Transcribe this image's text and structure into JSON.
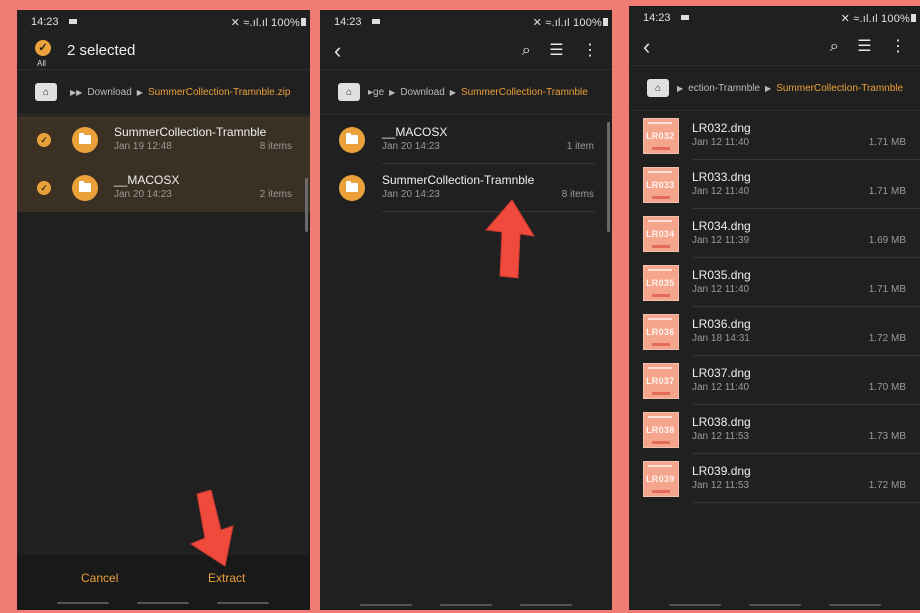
{
  "status": {
    "time": "14:23",
    "right": "✕ ≈.ıl.ıl 100%"
  },
  "panel1": {
    "selected_title": "2 selected",
    "all_label": "All",
    "breadcrumb": {
      "parent": "Download",
      "current": "SummerCollection-Tramnble.zip"
    },
    "items": [
      {
        "name": "SummerCollection-Tramnble",
        "date": "Jan 19 12:48",
        "meta": "8 items"
      },
      {
        "name": "__MACOSX",
        "date": "Jan 20 14:23",
        "meta": "2 items"
      }
    ],
    "cancel_label": "Cancel",
    "extract_label": "Extract"
  },
  "panel2": {
    "breadcrumb": {
      "prefix": "▸ge",
      "parent": "Download",
      "current": "SummerCollection-Tramnble"
    },
    "items": [
      {
        "name": "__MACOSX",
        "date": "Jan 20 14:23",
        "meta": "1 item"
      },
      {
        "name": "SummerCollection-Tramnble",
        "date": "Jan 20 14:23",
        "meta": "8 items"
      }
    ]
  },
  "panel3": {
    "breadcrumb": {
      "parent": "ection-Tramnble",
      "current": "SummerCollection-Tramnble"
    },
    "files": [
      {
        "name": "LR032.dng",
        "date": "Jan 12 11:40",
        "size": "1.71 MB",
        "thumb": "LR032"
      },
      {
        "name": "LR033.dng",
        "date": "Jan 12 11:40",
        "size": "1.71 MB",
        "thumb": "LR033"
      },
      {
        "name": "LR034.dng",
        "date": "Jan 12 11:39",
        "size": "1.69 MB",
        "thumb": "LR034"
      },
      {
        "name": "LR035.dng",
        "date": "Jan 12 11:40",
        "size": "1.71 MB",
        "thumb": "LR035"
      },
      {
        "name": "LR036.dng",
        "date": "Jan 18 14:31",
        "size": "1.72 MB",
        "thumb": "LR036"
      },
      {
        "name": "LR037.dng",
        "date": "Jan 12 11:40",
        "size": "1.70 MB",
        "thumb": "LR037"
      },
      {
        "name": "LR038.dng",
        "date": "Jan 12 11:53",
        "size": "1.73 MB",
        "thumb": "LR038"
      },
      {
        "name": "LR039.dng",
        "date": "Jan 12 11:53",
        "size": "1.72 MB",
        "thumb": "LR039"
      }
    ]
  },
  "colors": {
    "accent": "#eba13a",
    "background": "#202020",
    "frame": "#f07c74",
    "arrow": "#f04a3c"
  },
  "icons": [
    "back-arrow-icon",
    "search-icon",
    "list-view-icon",
    "more-vert-icon",
    "home-icon",
    "folder-icon",
    "check-icon"
  ]
}
